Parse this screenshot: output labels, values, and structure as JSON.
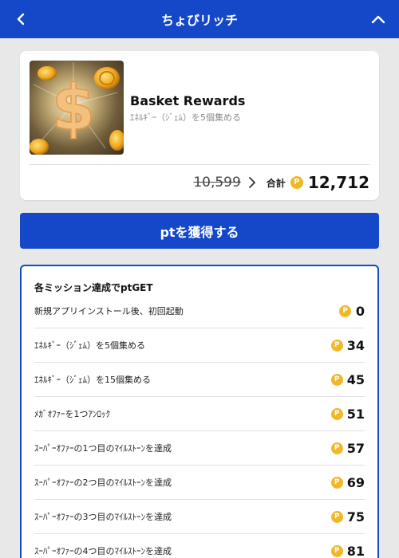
{
  "header": {
    "title": "ちょびリッチ"
  },
  "offer": {
    "name": "Basket Rewards",
    "subtitle": "ｴﾈﾙｷﾞｰ（ｼﾞｪﾑ）を5個集める",
    "old_price": "10,599",
    "total_label": "合計",
    "new_price": "12,712"
  },
  "cta": {
    "label": "ptを獲得する"
  },
  "missions": {
    "title": "各ミッション達成でptGET",
    "items": [
      {
        "label": "新規アプリインストール後、初回起動",
        "points": "0"
      },
      {
        "label": "ｴﾈﾙｷﾞｰ（ｼﾞｪﾑ）を5個集める",
        "points": "34"
      },
      {
        "label": "ｴﾈﾙｷﾞｰ（ｼﾞｪﾑ）を15個集める",
        "points": "45"
      },
      {
        "label": "ﾒｶﾞｵﾌｧｰを1つｱﾝﾛｯｸ",
        "points": "51"
      },
      {
        "label": "ｽｰﾊﾟｰｵﾌｧｰの1つ目のﾏｲﾙｽﾄｰﾝを達成",
        "points": "57"
      },
      {
        "label": "ｽｰﾊﾟｰｵﾌｧｰの2つ目のﾏｲﾙｽﾄｰﾝを達成",
        "points": "69"
      },
      {
        "label": "ｽｰﾊﾟｰｵﾌｧｰの3つ目のﾏｲﾙｽﾄｰﾝを達成",
        "points": "75"
      },
      {
        "label": "ｽｰﾊﾟｰｵﾌｧｰの4つ目のﾏｲﾙｽﾄｰﾝを達成",
        "points": "81"
      }
    ]
  },
  "icons": {
    "back": "chevron-left-icon",
    "collapse": "chevron-up-icon",
    "point_coin": "point-coin-icon",
    "arrow": "chevron-right-icon"
  },
  "colors": {
    "brand": "#1448c8",
    "coin": "#f0b829",
    "background": "#e8e8e8"
  }
}
